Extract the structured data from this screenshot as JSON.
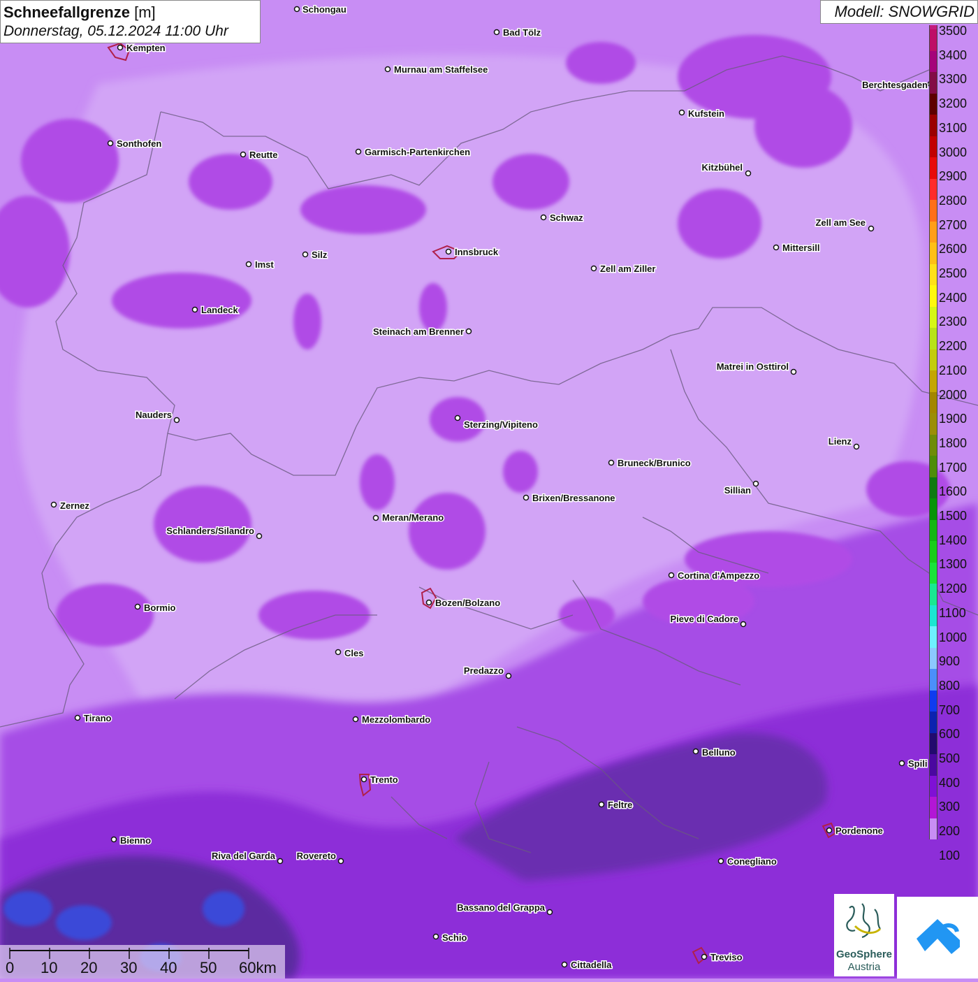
{
  "title": {
    "name": "Schneefallgrenze",
    "unit": "[m]",
    "datetime": "Donnerstag, 05.12.2024 11:00 Uhr"
  },
  "model": "Modell: SNOWGRID",
  "legend": {
    "colors": [
      "#c31d7d",
      "#be0e67",
      "#a5047a",
      "#830c46",
      "#5e0000",
      "#9b0000",
      "#c20000",
      "#e80a0a",
      "#ff2b2b",
      "#ff6f1a",
      "#ff9e1a",
      "#ffbf17",
      "#ffe01a",
      "#fff80f",
      "#d6f716",
      "#b8e21a",
      "#c3cc0c",
      "#c4a603",
      "#a38600",
      "#9b8e08",
      "#6f8c09",
      "#4e8d09",
      "#0f7a12",
      "#089408",
      "#14b614",
      "#1ace1a",
      "#1ae23a",
      "#19e892",
      "#1ce6d2",
      "#6ef0ff",
      "#8cc8ff",
      "#4b8ffb",
      "#0f3bf0",
      "#0c22b0",
      "#220a6e",
      "#4a08a0",
      "#7f10d6",
      "#b316d6",
      "#c88df4"
    ],
    "labels": [
      "3500",
      "3400",
      "3300",
      "3200",
      "3100",
      "3000",
      "2900",
      "2800",
      "2700",
      "2600",
      "2500",
      "2400",
      "2300",
      "2200",
      "2100",
      "2000",
      "1900",
      "1800",
      "1700",
      "1600",
      "1500",
      "1400",
      "1300",
      "1200",
      "1100",
      "1000",
      "900",
      "800",
      "700",
      "600",
      "500",
      "400",
      "300",
      "200",
      "100"
    ]
  },
  "cities": [
    {
      "name": "Schongau"
    },
    {
      "name": "Bad Tölz"
    },
    {
      "name": "Kempten"
    },
    {
      "name": "Murnau am Staffelsee"
    },
    {
      "name": "Berchtesgaden"
    },
    {
      "name": "Kufstein"
    },
    {
      "name": "Sonthofen"
    },
    {
      "name": "Reutte"
    },
    {
      "name": "Garmisch-Partenkirchen"
    },
    {
      "name": "Kitzbühel"
    },
    {
      "name": "Schwaz"
    },
    {
      "name": "Zell am See"
    },
    {
      "name": "Innsbruck"
    },
    {
      "name": "Mittersill"
    },
    {
      "name": "Imst"
    },
    {
      "name": "Silz"
    },
    {
      "name": "Zell am Ziller"
    },
    {
      "name": "Landeck"
    },
    {
      "name": "Steinach am Brenner"
    },
    {
      "name": "Matrei in Osttirol"
    },
    {
      "name": "Nauders"
    },
    {
      "name": "Sterzing/Vipiteno"
    },
    {
      "name": "Lienz"
    },
    {
      "name": "Bruneck/Brunico"
    },
    {
      "name": "Sillian"
    },
    {
      "name": "Zernez"
    },
    {
      "name": "Brixen/Bressanone"
    },
    {
      "name": "Meran/Merano"
    },
    {
      "name": "Schlanders/Silandro"
    },
    {
      "name": "Cortina d'Ampezzo"
    },
    {
      "name": "Bozen/Bolzano"
    },
    {
      "name": "Bormio"
    },
    {
      "name": "Pieve di Cadore"
    },
    {
      "name": "Cles"
    },
    {
      "name": "Predazzo"
    },
    {
      "name": "Tirano"
    },
    {
      "name": "Mezzolombardo"
    },
    {
      "name": "Belluno"
    },
    {
      "name": "Spili"
    },
    {
      "name": "Trento"
    },
    {
      "name": "Feltre"
    },
    {
      "name": "Pordenone"
    },
    {
      "name": "Bienno"
    },
    {
      "name": "Riva del Garda"
    },
    {
      "name": "Rovereto"
    },
    {
      "name": "Conegliano"
    },
    {
      "name": "Bassano del Grappa"
    },
    {
      "name": "Schio"
    },
    {
      "name": "Treviso"
    },
    {
      "name": "Cittadella"
    }
  ],
  "scale": {
    "labels": [
      "0",
      "10",
      "20",
      "30",
      "40",
      "50",
      "60km"
    ]
  },
  "logos": {
    "geosphere_line1": "GeoSphere",
    "geosphere_line2": "Austria"
  }
}
